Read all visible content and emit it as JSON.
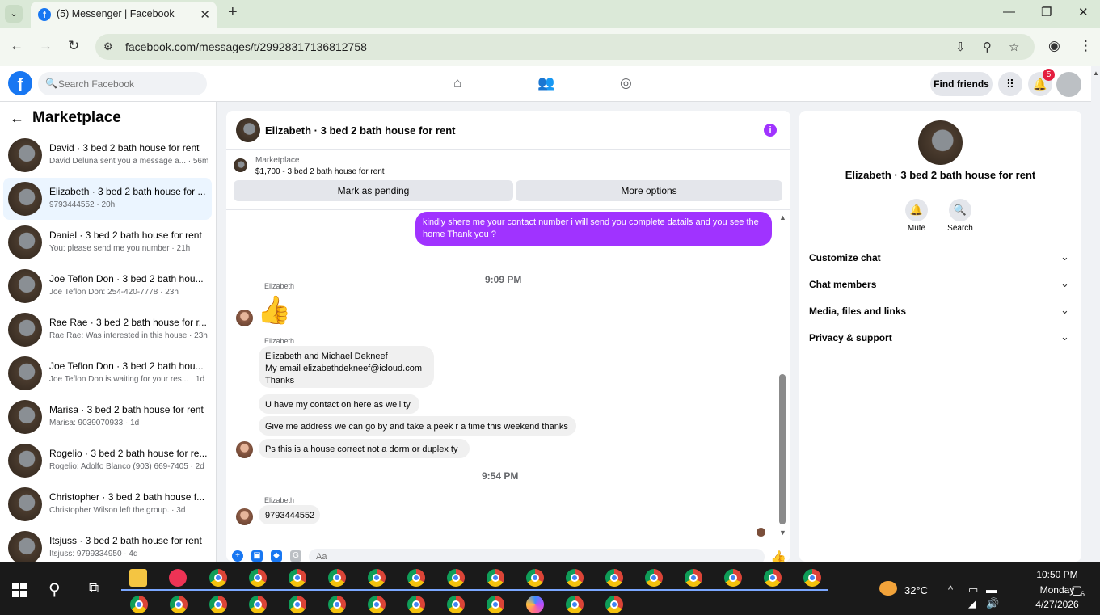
{
  "browser": {
    "tab_title": "(5) Messenger | Facebook",
    "url": "facebook.com/messages/t/29928317136812758"
  },
  "fb": {
    "search_placeholder": "Search Facebook",
    "find_friends": "Find friends",
    "notification_count": "5"
  },
  "sidebar": {
    "title": "Marketplace",
    "conversations": [
      {
        "title": "David · 3 bed 2 bath house for rent",
        "subtitle": "David Deluna sent you a message a... · 56m",
        "active": false
      },
      {
        "title": "Elizabeth · 3 bed 2 bath house for ...",
        "subtitle": "9793444552 · 20h",
        "active": true
      },
      {
        "title": "Daniel · 3 bed 2 bath house for rent",
        "subtitle": "You: please send me you number · 21h",
        "active": false
      },
      {
        "title": "Joe Teflon Don · 3 bed 2 bath hou...",
        "subtitle": "Joe Teflon Don: 254-420-7778 · 23h",
        "active": false
      },
      {
        "title": "Rae Rae · 3 bed 2 bath house for r...",
        "subtitle": "Rae Rae: Was interested in this house · 23h",
        "active": false
      },
      {
        "title": "Joe Teflon Don · 3 bed 2 bath hou...",
        "subtitle": "Joe Teflon Don is waiting for your res... · 1d",
        "active": false
      },
      {
        "title": "Marisa · 3 bed 2 bath house for rent",
        "subtitle": "Marisa: 9039070933 · 1d",
        "active": false
      },
      {
        "title": "Rogelio · 3 bed 2 bath house for re...",
        "subtitle": "Rogelio: Adolfo Blanco (903) 669-7405 · 2d",
        "active": false
      },
      {
        "title": "Christopher · 3 bed 2 bath house f...",
        "subtitle": "Christopher Wilson left the group. · 3d",
        "active": false
      },
      {
        "title": "Itsjuss · 3 bed 2 bath house for rent",
        "subtitle": "Itsjuss: 9799334950 · 4d",
        "active": false
      }
    ]
  },
  "chat": {
    "title": "Elizabeth · 3 bed 2 bath house for rent",
    "marketplace_label": "Marketplace",
    "listing": "$1,700 - 3 bed 2 bath house for rent",
    "mark_pending": "Mark as pending",
    "more_options": "More options",
    "outgoing_message": "kindly shere me your contact number i will send you complete datails and you see the home Thank you ?",
    "time_1": "9:09 PM",
    "time_2": "9:54 PM",
    "sender": "Elizabeth",
    "messages": [
      "Elizabeth and Michael Dekneef\nMy email  elizabethdekneef@icloud.com\nThanks",
      "U have my contact on here as well ty",
      "Give me address we can go by and take a peek r a time this weekend thanks",
      "Ps this is a house correct not a dorm or duplex  ty",
      "9793444552"
    ],
    "composer_placeholder": "Aa"
  },
  "info_panel": {
    "name": "Elizabeth · 3 bed 2 bath house for rent",
    "mute": "Mute",
    "search": "Search",
    "sections": [
      "Customize chat",
      "Chat members",
      "Media, files and links",
      "Privacy & support"
    ]
  },
  "taskbar": {
    "temperature": "32°C",
    "time": "10:50 PM",
    "day": "Monday",
    "date": "4/27/2026",
    "notification_count": "6"
  },
  "colors": {
    "accent_purple": "#a033ff",
    "facebook_blue": "#1877f2",
    "browser_green": "#dbe9d8"
  }
}
